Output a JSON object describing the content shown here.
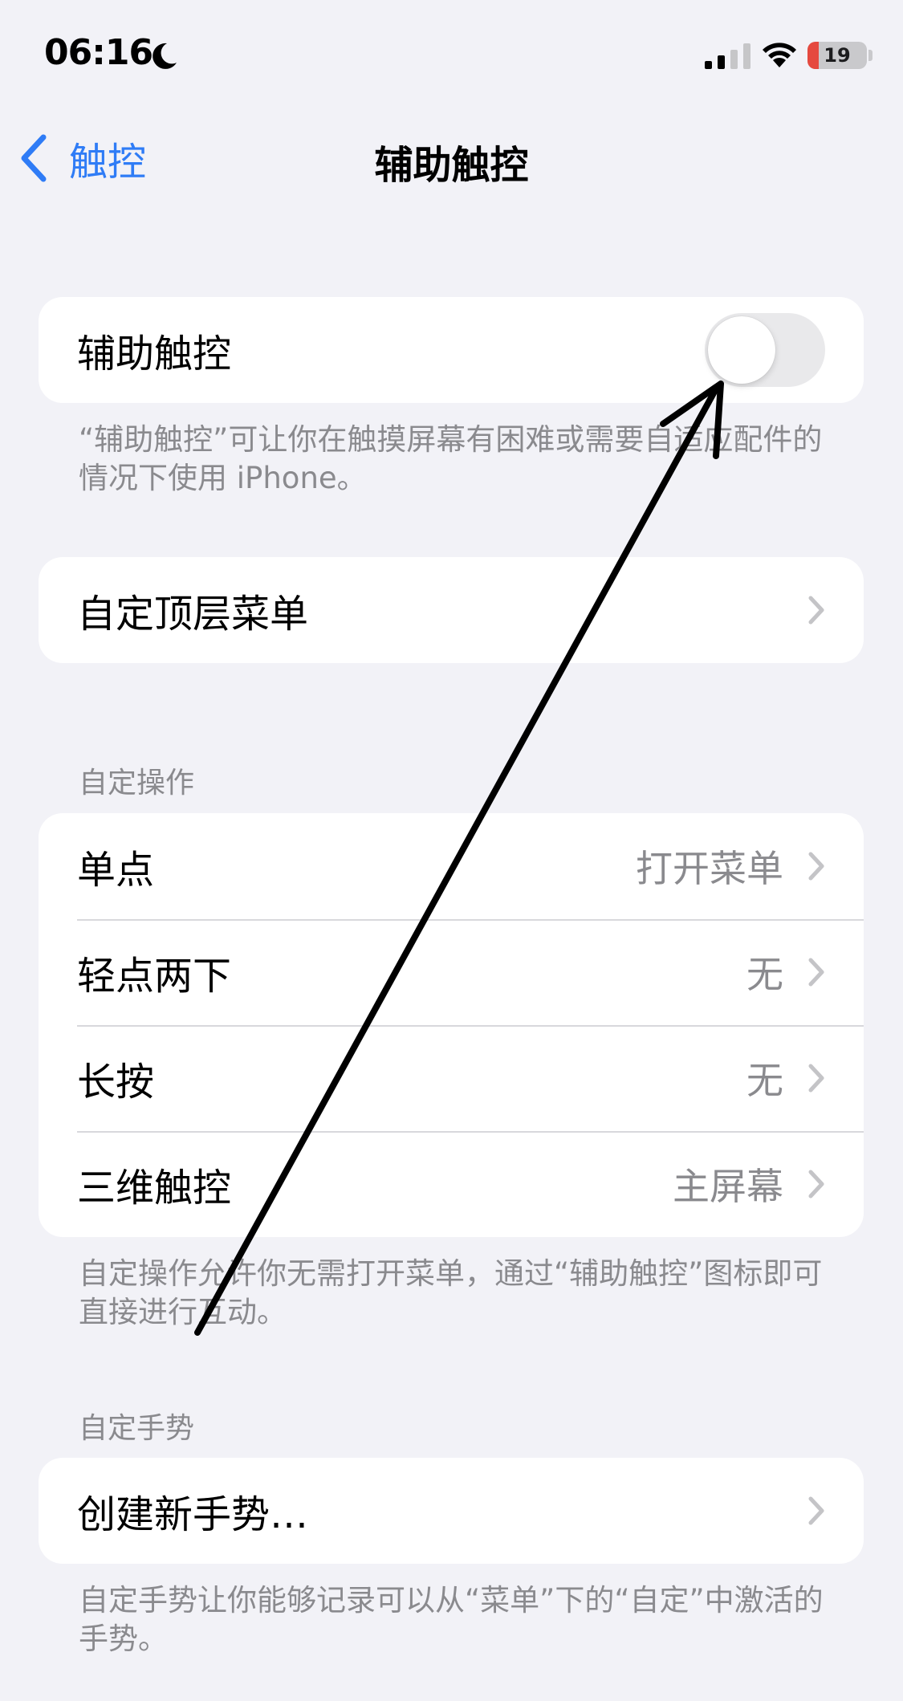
{
  "status_bar": {
    "time": "06:16",
    "battery_level": "19",
    "battery_percent": 19,
    "battery_color": "#e5493f"
  },
  "nav": {
    "back_label": "触控",
    "title": "辅助触控"
  },
  "assistive_touch": {
    "label": "辅助触控",
    "enabled": false,
    "footer": "“辅助触控”可让你在触摸屏幕有困难或需要自适应配件的情况下使用 iPhone。"
  },
  "customize_menu": {
    "label": "自定顶层菜单"
  },
  "custom_actions": {
    "header": "自定操作",
    "rows": [
      {
        "label": "单点",
        "value": "打开菜单"
      },
      {
        "label": "轻点两下",
        "value": "无"
      },
      {
        "label": "长按",
        "value": "无"
      },
      {
        "label": "三维触控",
        "value": "主屏幕"
      }
    ],
    "footer": "自定操作允许你无需打开菜单，通过“辅助触控”图标即可直接进行互动。"
  },
  "custom_gestures": {
    "header": "自定手势",
    "create_label": "创建新手势…",
    "footer": "自定手势让你能够记录可以从“菜单”下的“自定”中激活的手势。"
  },
  "colors": {
    "accent": "#2f7cf6",
    "background": "#f2f2f7",
    "secondary_text": "#8a8a8e"
  }
}
